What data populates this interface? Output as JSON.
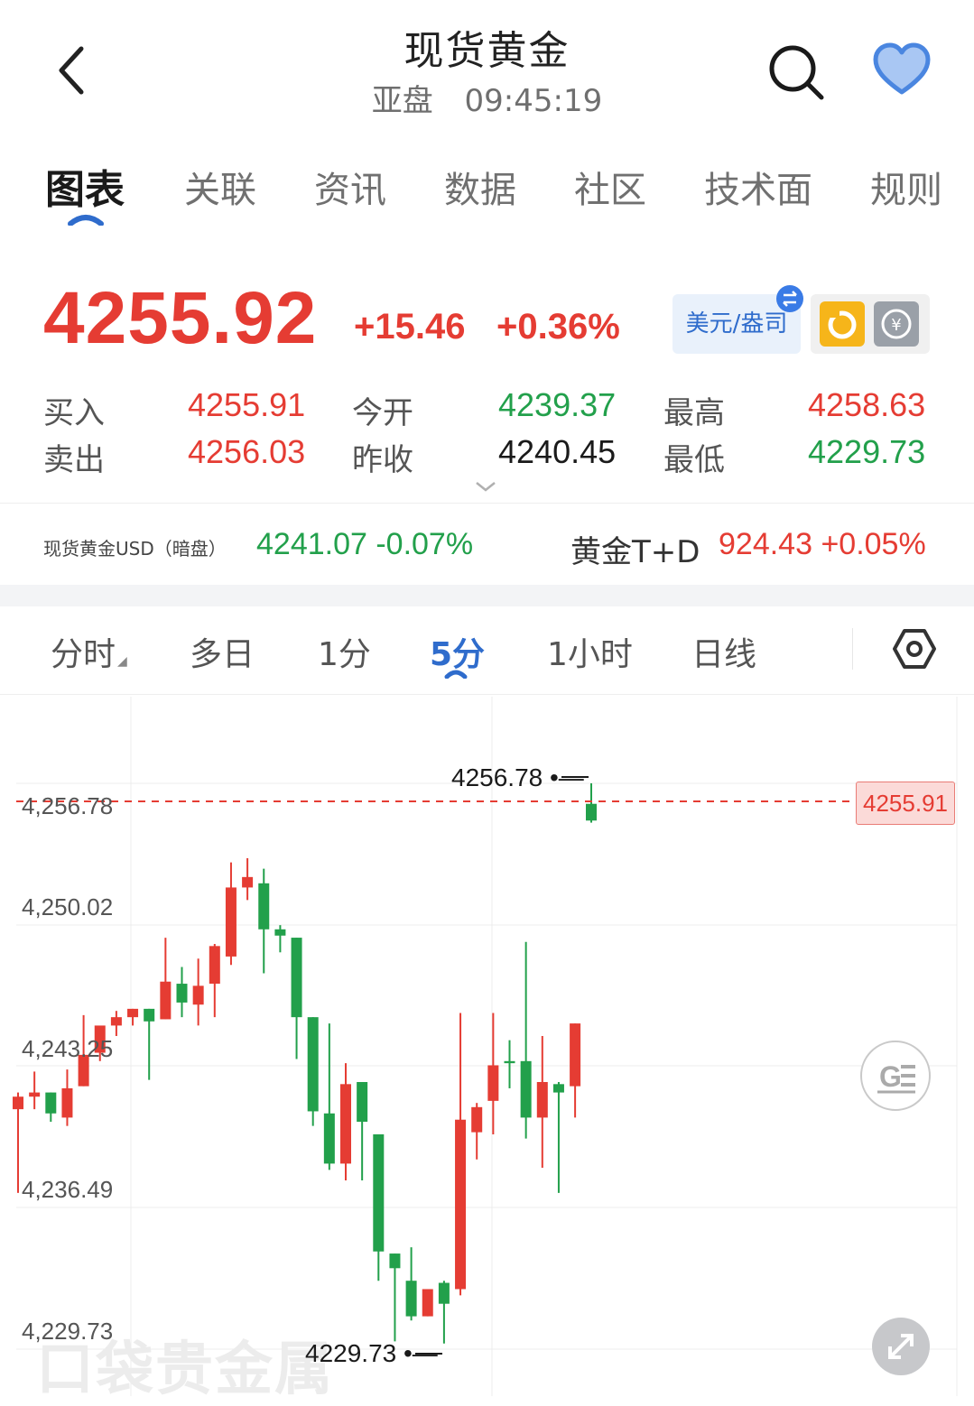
{
  "header": {
    "title": "现货黄金",
    "session": "亚盘",
    "time": "09:45:19"
  },
  "tabs": [
    "图表",
    "关联",
    "资讯",
    "数据",
    "社区",
    "技术面",
    "规则"
  ],
  "active_tab": "图表",
  "quote": {
    "last": "4255.92",
    "change": "+15.46",
    "change_pct": "+0.36%",
    "unit_label": "美元/盎司",
    "bid_label": "买入",
    "bid": "4255.91",
    "ask_label": "卖出",
    "ask": "4256.03",
    "open_label": "今开",
    "open": "4239.37",
    "prev_close_label": "昨收",
    "prev_close": "4240.45",
    "high_label": "最高",
    "high": "4258.63",
    "low_label": "最低",
    "low": "4229.73"
  },
  "related": {
    "item1_name": "现货黄金USD（暗盘）",
    "item1_value": "4241.07 -0.07%",
    "item2_name": "黄金T+D",
    "item2_value": "924.43 +0.05%"
  },
  "periods": [
    "分时",
    "多日",
    "1分",
    "5分",
    "1小时",
    "日线"
  ],
  "active_period": "5分",
  "colors": {
    "up": "#e53c33",
    "down": "#22a04b",
    "accent": "#2f6ccc"
  },
  "icons": [
    "back-arrow-icon",
    "search-icon",
    "heart-icon",
    "swap-icon",
    "refresh-icon",
    "currency-icon",
    "settings-hexagon-icon",
    "ge-icon",
    "fullscreen-icon"
  ],
  "watermark": "口袋贵金属",
  "chart_data": {
    "type": "candlestick",
    "y_tick_labels": [
      "4,256.78",
      "4,250.02",
      "4,243.25",
      "4,236.49",
      "4,229.73"
    ],
    "ylim": [
      4229.73,
      4256.78
    ],
    "current_price_label": "4255.91",
    "max_marker": "4256.78",
    "min_marker": "4229.73",
    "grid": true,
    "candles": [
      {
        "o": 4241.2,
        "h": 4242.0,
        "l": 4237.2,
        "c": 4241.8
      },
      {
        "o": 4241.8,
        "h": 4243.0,
        "l": 4241.2,
        "c": 4242.0
      },
      {
        "o": 4242.0,
        "h": 4242.0,
        "l": 4240.6,
        "c": 4241.0
      },
      {
        "o": 4240.8,
        "h": 4243.1,
        "l": 4240.4,
        "c": 4242.2
      },
      {
        "o": 4242.3,
        "h": 4245.7,
        "l": 4242.3,
        "c": 4243.8
      },
      {
        "o": 4243.9,
        "h": 4245.1,
        "l": 4243.5,
        "c": 4245.2
      },
      {
        "o": 4245.2,
        "h": 4245.9,
        "l": 4244.7,
        "c": 4245.6
      },
      {
        "o": 4245.6,
        "h": 4246.0,
        "l": 4245.2,
        "c": 4246.0
      },
      {
        "o": 4246.0,
        "h": 4246.0,
        "l": 4242.6,
        "c": 4245.4
      },
      {
        "o": 4245.5,
        "h": 4249.4,
        "l": 4245.5,
        "c": 4247.3
      },
      {
        "o": 4247.2,
        "h": 4248.0,
        "l": 4245.6,
        "c": 4246.3
      },
      {
        "o": 4246.2,
        "h": 4248.4,
        "l": 4245.2,
        "c": 4247.1
      },
      {
        "o": 4247.2,
        "h": 4249.1,
        "l": 4245.6,
        "c": 4249.0
      },
      {
        "o": 4248.5,
        "h": 4253.0,
        "l": 4248.1,
        "c": 4251.8
      },
      {
        "o": 4251.8,
        "h": 4253.2,
        "l": 4251.2,
        "c": 4252.3
      },
      {
        "o": 4252.0,
        "h": 4252.7,
        "l": 4247.7,
        "c": 4249.8
      },
      {
        "o": 4249.8,
        "h": 4250.0,
        "l": 4248.7,
        "c": 4249.5
      },
      {
        "o": 4249.4,
        "h": 4249.4,
        "l": 4243.6,
        "c": 4245.6
      },
      {
        "o": 4245.6,
        "h": 4245.6,
        "l": 4240.4,
        "c": 4241.1
      },
      {
        "o": 4241.0,
        "h": 4245.3,
        "l": 4238.3,
        "c": 4238.6
      },
      {
        "o": 4238.6,
        "h": 4243.4,
        "l": 4237.8,
        "c": 4242.4
      },
      {
        "o": 4242.5,
        "h": 4242.5,
        "l": 4237.8,
        "c": 4240.6
      },
      {
        "o": 4240.0,
        "h": 4240.0,
        "l": 4233.0,
        "c": 4234.4
      },
      {
        "o": 4234.3,
        "h": 4234.3,
        "l": 4230.1,
        "c": 4233.6
      },
      {
        "o": 4233.0,
        "h": 4234.6,
        "l": 4231.1,
        "c": 4231.3
      },
      {
        "o": 4231.3,
        "h": 4232.5,
        "l": 4231.3,
        "c": 4232.6
      },
      {
        "o": 4232.9,
        "h": 4233.0,
        "l": 4230.0,
        "c": 4231.9
      },
      {
        "o": 4232.6,
        "h": 4245.8,
        "l": 4232.3,
        "c": 4240.7
      },
      {
        "o": 4240.1,
        "h": 4241.5,
        "l": 4238.8,
        "c": 4241.3
      },
      {
        "o": 4241.6,
        "h": 4245.8,
        "l": 4240.0,
        "c": 4243.3
      },
      {
        "o": 4243.5,
        "h": 4244.5,
        "l": 4242.2,
        "c": 4243.4
      },
      {
        "o": 4243.5,
        "h": 4249.2,
        "l": 4239.8,
        "c": 4240.8
      },
      {
        "o": 4240.8,
        "h": 4244.7,
        "l": 4238.4,
        "c": 4242.5
      },
      {
        "o": 4242.4,
        "h": 4242.5,
        "l": 4237.2,
        "c": 4242.0
      },
      {
        "o": 4242.3,
        "h": 4245.3,
        "l": 4240.8,
        "c": 4245.3
      },
      {
        "o": 4255.8,
        "h": 4256.78,
        "l": 4254.9,
        "c": 4255.0
      }
    ]
  }
}
